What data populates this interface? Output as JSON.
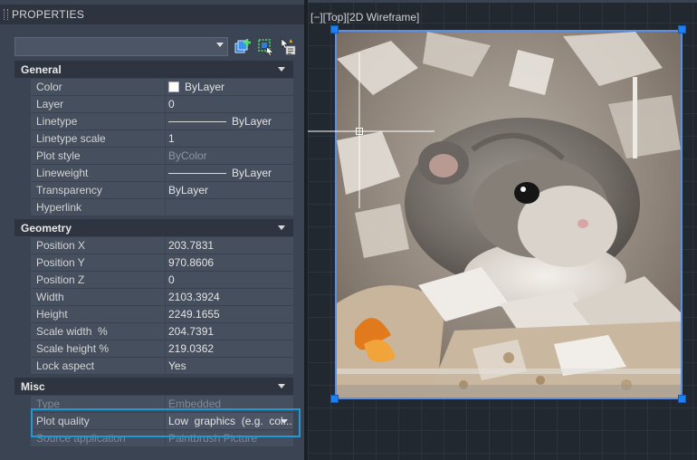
{
  "panel": {
    "title": "PROPERTIES",
    "selector": {
      "value": ""
    }
  },
  "viewport": {
    "label": "[−][Top][2D Wireframe]"
  },
  "sections": {
    "general": {
      "title": "General",
      "rows": [
        {
          "label": "Color",
          "value": "ByLayer"
        },
        {
          "label": "Layer",
          "value": "0"
        },
        {
          "label": "Linetype",
          "value": "ByLayer"
        },
        {
          "label": "Linetype scale",
          "value": "1"
        },
        {
          "label": "Plot style",
          "value": "ByColor"
        },
        {
          "label": "Lineweight",
          "value": "ByLayer"
        },
        {
          "label": "Transparency",
          "value": "ByLayer"
        },
        {
          "label": "Hyperlink",
          "value": ""
        }
      ]
    },
    "geometry": {
      "title": "Geometry",
      "rows": [
        {
          "label": "Position X",
          "value": "203.7831"
        },
        {
          "label": "Position Y",
          "value": "970.8606"
        },
        {
          "label": "Position Z",
          "value": "0"
        },
        {
          "label": "Width",
          "value": "2103.3924"
        },
        {
          "label": "Height",
          "value": "2249.1655"
        },
        {
          "label": "Scale width  %",
          "value": "204.7391"
        },
        {
          "label": "Scale height %",
          "value": "219.0362"
        },
        {
          "label": "Lock aspect",
          "value": "Yes"
        }
      ]
    },
    "misc": {
      "title": "Misc",
      "rows": [
        {
          "label": "Type",
          "value": "Embedded"
        },
        {
          "label": "Plot quality",
          "value": "Low  graphics  (e.g.  col..."
        },
        {
          "label": "Source application",
          "value": "Paintbrush Picture"
        }
      ]
    }
  },
  "colors": {
    "accent": "#1f9ad6",
    "grip": "#1e7ff0",
    "panel": "#3b4453"
  }
}
